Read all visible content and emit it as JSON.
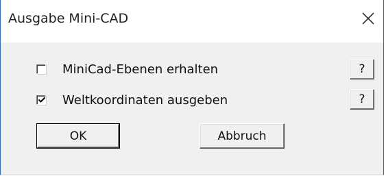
{
  "window": {
    "title": "Ausgabe Mini-CAD",
    "close_icon": "close-icon"
  },
  "options": [
    {
      "label": "MiniCad-Ebenen erhalten",
      "checked": false,
      "help_label": "?"
    },
    {
      "label": "Weltkoordinaten ausgeben",
      "checked": true,
      "help_label": "?"
    }
  ],
  "buttons": {
    "ok_label": "OK",
    "cancel_label": "Abbruch"
  }
}
